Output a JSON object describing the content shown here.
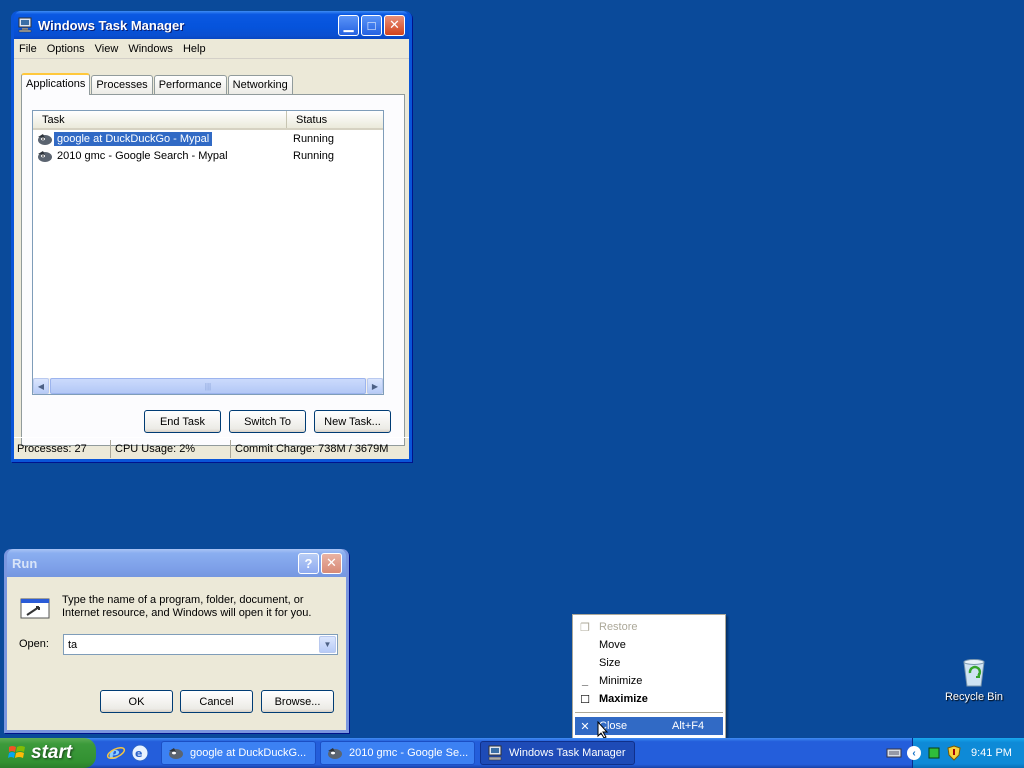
{
  "colors": {
    "desktop": "#0a4a9a",
    "selection": "#316ac5",
    "titlebar_active": "#0553db",
    "start_green": "#3c9a3b"
  },
  "taskmgr": {
    "title": "Windows Task Manager",
    "menu": [
      "File",
      "Options",
      "View",
      "Windows",
      "Help"
    ],
    "tabs": [
      "Applications",
      "Processes",
      "Performance",
      "Networking"
    ],
    "columns": {
      "task": "Task",
      "status": "Status"
    },
    "rows": [
      {
        "task": "google at DuckDuckGo - Mypal",
        "status": "Running"
      },
      {
        "task": "2010 gmc - Google Search - Mypal",
        "status": "Running"
      }
    ],
    "buttons": {
      "end_task": "End Task",
      "switch_to": "Switch To",
      "new_task": "New Task..."
    },
    "status": {
      "processes": "Processes: 27",
      "cpu": "CPU Usage: 2%",
      "commit": "Commit Charge: 738M / 3679M"
    }
  },
  "run": {
    "title": "Run",
    "description": "Type the name of a program, folder, document, or Internet resource, and Windows will open it for you.",
    "open_label": "Open:",
    "open_value": "ta",
    "buttons": {
      "ok": "OK",
      "cancel": "Cancel",
      "browse": "Browse..."
    }
  },
  "context_menu": {
    "items": [
      {
        "label": "Restore",
        "state": "disabled"
      },
      {
        "label": "Move"
      },
      {
        "label": "Size"
      },
      {
        "label": "Minimize"
      },
      {
        "label": "Maximize",
        "state": "bold"
      },
      {
        "label": "Close",
        "accel": "Alt+F4",
        "state": "highlighted"
      }
    ]
  },
  "desktop": {
    "recycle_bin": "Recycle Bin"
  },
  "taskbar": {
    "start": "start",
    "tasks": [
      {
        "label": "google at DuckDuckG...",
        "icon": "mypal-icon"
      },
      {
        "label": "2010 gmc - Google Se...",
        "icon": "mypal-icon"
      },
      {
        "label": "Windows Task Manager",
        "icon": "taskmgr-icon",
        "active": true
      }
    ],
    "clock": "9:41 PM"
  }
}
